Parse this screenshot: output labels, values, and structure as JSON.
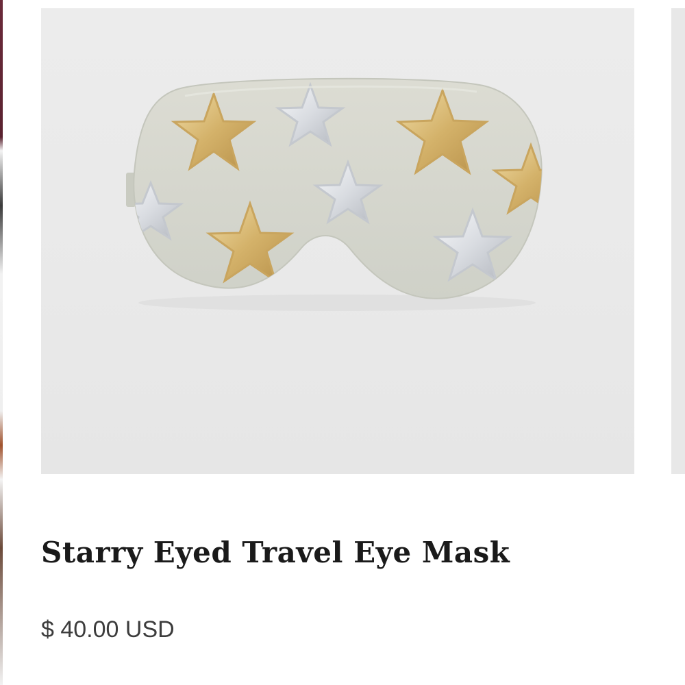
{
  "product": {
    "title": "Starry Eyed Travel Eye Mask",
    "price": "$ 40.00 USD",
    "image": {
      "subject": "eye-mask-with-stars",
      "colors": {
        "background": "#e9e9e9",
        "mask": "#d6d8d0",
        "gold_star": "#d4b26a",
        "silver_star": "#dcdfe3"
      }
    }
  }
}
